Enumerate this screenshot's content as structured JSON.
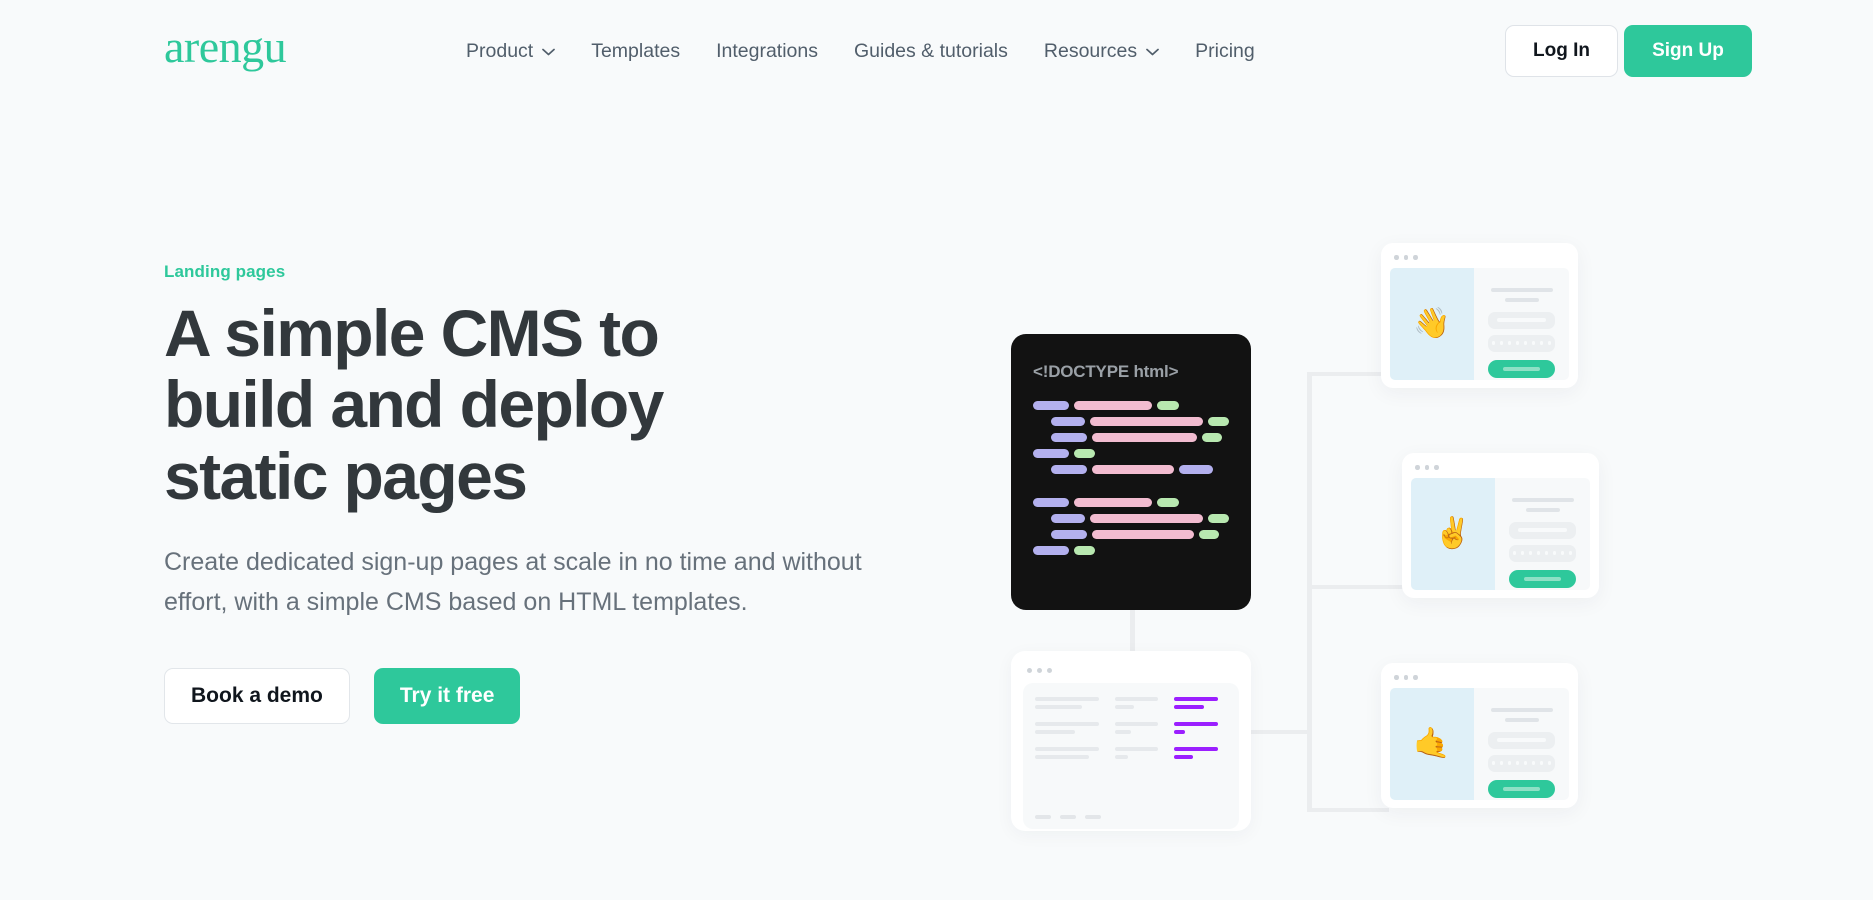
{
  "brand": {
    "logo": "arengu",
    "accent": "#2ec89b"
  },
  "nav": {
    "items": [
      {
        "label": "Product",
        "has_chevron": true,
        "icon": "chevron-down-icon"
      },
      {
        "label": "Templates",
        "has_chevron": false
      },
      {
        "label": "Integrations",
        "has_chevron": false
      },
      {
        "label": "Guides & tutorials",
        "has_chevron": false
      },
      {
        "label": "Resources",
        "has_chevron": true,
        "icon": "chevron-down-icon"
      },
      {
        "label": "Pricing",
        "has_chevron": false
      }
    ],
    "login_label": "Log In",
    "signup_label": "Sign Up"
  },
  "hero": {
    "eyebrow": "Landing pages",
    "title": "A simple CMS to build and deploy static pages",
    "subtitle": "Create dedicated sign-up pages at scale in no time and without effort, with a simple CMS based on HTML templates.",
    "cta_secondary": "Book a demo",
    "cta_primary": "Try it free"
  },
  "illustration": {
    "code_card": {
      "doctype": "<!DOCTYPE html>",
      "background": "#121212",
      "token_colors": {
        "keyword": "#b3b0ee",
        "string": "#f2bcd0",
        "value": "#b8e8b0"
      }
    },
    "dashboard_card": {
      "highlight_color": "#9b1fff",
      "rows": 3,
      "columns": 3,
      "footer_bars": 3
    },
    "browser_cards": [
      {
        "emoji": "👋",
        "icon": "waving-hand-emoji",
        "panel_color": "#dff0f8",
        "button_color": "#2ec89b"
      },
      {
        "emoji": "✌️",
        "icon": "victory-hand-emoji",
        "panel_color": "#dff0f8",
        "button_color": "#2ec89b"
      },
      {
        "emoji": "🤙",
        "icon": "call-me-hand-emoji",
        "panel_color": "#dff0f8",
        "button_color": "#2ec89b"
      }
    ],
    "connector_color": "#ebedef"
  }
}
